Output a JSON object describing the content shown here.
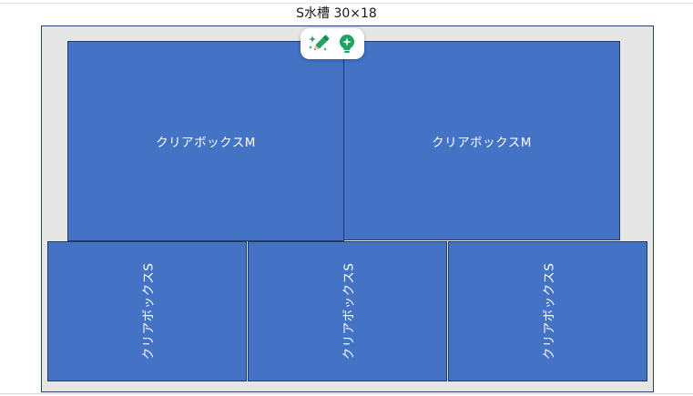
{
  "tank": {
    "title": "S水槽 30×18"
  },
  "boxes": {
    "m_left": "クリアボックスM",
    "m_right": "クリアボックスM",
    "s1": "クリアボックスS",
    "s2": "クリアボックスS",
    "s3": "クリアボックスS"
  },
  "toolbar": {
    "icons": [
      "magic-pencil-icon",
      "lightbulb-icon"
    ]
  },
  "colors": {
    "box_fill": "#4472c4",
    "tank_fill": "#e6e6e6",
    "accent_green": "#1ea362"
  }
}
